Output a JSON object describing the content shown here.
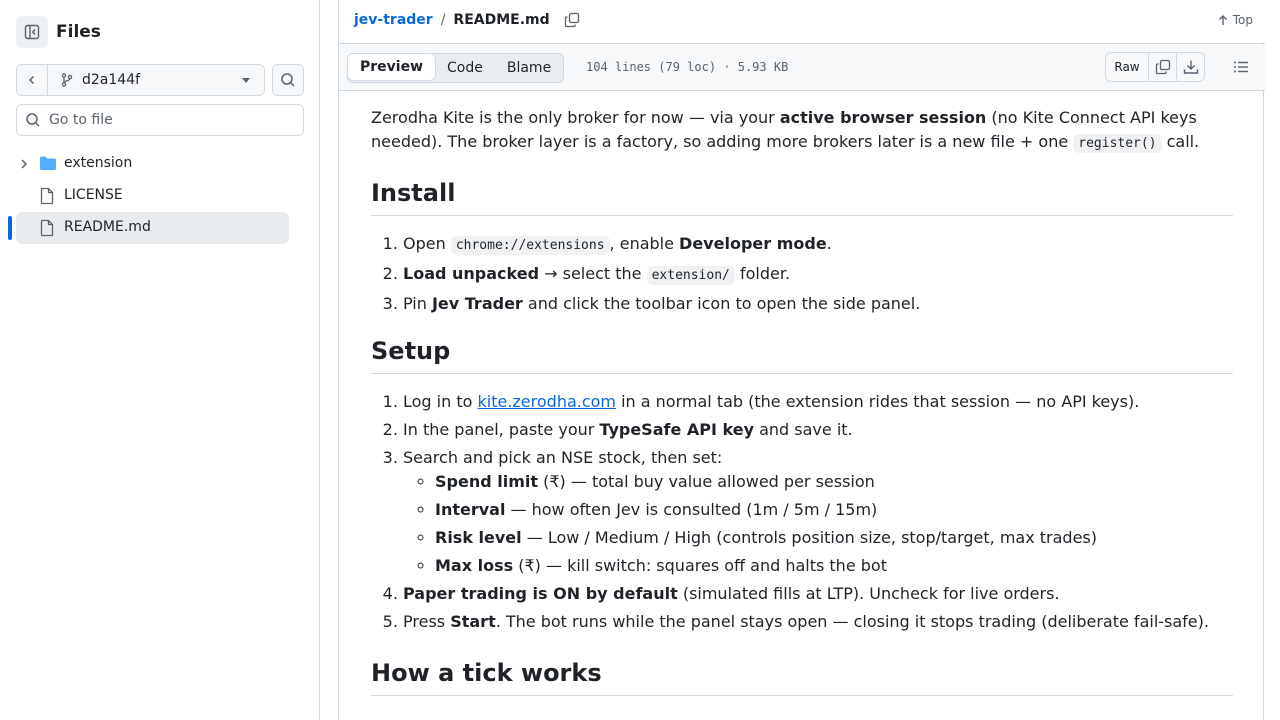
{
  "sidebar": {
    "title": "Files",
    "branch": "d2a144f",
    "goto_placeholder": "Go to file",
    "tree": [
      {
        "label": "extension",
        "type": "folder"
      },
      {
        "label": "LICENSE",
        "type": "file"
      },
      {
        "label": "README.md",
        "type": "file",
        "active": true
      }
    ]
  },
  "header": {
    "repo": "jev-trader",
    "separator": "/",
    "file": "README.md",
    "top_label": "Top"
  },
  "toolbar": {
    "tabs": [
      "Preview",
      "Code",
      "Blame"
    ],
    "selected_tab": "Preview",
    "file_info": "104 lines (79 loc) · 5.93 KB",
    "raw_label": "Raw"
  },
  "content": {
    "intro": {
      "t1": "Zerodha Kite is the only broker for now — via your ",
      "b1": "active browser session",
      "t2": " (no Kite Connect API keys needed). The broker layer is a factory, so adding more brokers later is a new file + one ",
      "c1": "register()",
      "t3": " call."
    },
    "install": {
      "heading": "Install",
      "s1": {
        "a": "Open ",
        "code": "chrome://extensions",
        "b": ", enable ",
        "strong": "Developer mode",
        "c": "."
      },
      "s2": {
        "strong": "Load unpacked",
        "a": " → select the ",
        "code": "extension/",
        "b": " folder."
      },
      "s3": {
        "a": "Pin ",
        "strong": "Jev Trader",
        "b": " and click the toolbar icon to open the side panel."
      }
    },
    "setup": {
      "heading": "Setup",
      "s1": {
        "a": "Log in to ",
        "link": "kite.zerodha.com",
        "b": " in a normal tab (the extension rides that session — no API keys)."
      },
      "s2": {
        "a": "In the panel, paste your ",
        "strong": "TypeSafe API key",
        "b": " and save it."
      },
      "s3": {
        "a": "Search and pick an NSE stock, then set:"
      },
      "sub": [
        {
          "strong": "Spend limit",
          "text": " (₹) — total buy value allowed per session"
        },
        {
          "strong": "Interval",
          "text": " — how often Jev is consulted (1m / 5m / 15m)"
        },
        {
          "strong": "Risk level",
          "text": " — Low / Medium / High (controls position size, stop/target, max trades)"
        },
        {
          "strong": "Max loss",
          "text": " (₹) — kill switch: squares off and halts the bot"
        }
      ],
      "s4": {
        "strong": "Paper trading is ON by default",
        "b": " (simulated fills at LTP). Uncheck for live orders."
      },
      "s5": {
        "a": "Press ",
        "strong": "Start",
        "b": ". The bot runs while the panel stays open — closing it stops trading (deliberate fail-safe)."
      }
    },
    "tick": {
      "heading": "How a tick works"
    }
  }
}
